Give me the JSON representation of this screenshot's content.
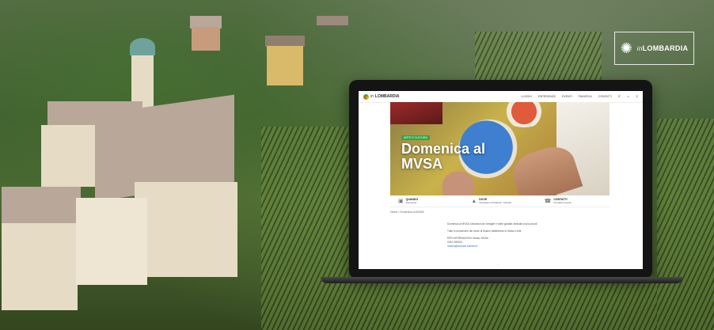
{
  "brand": {
    "logo_prefix": "in",
    "logo_name": "LOMBARDIA",
    "logo_icon": "sun-icon"
  },
  "site": {
    "brand_prefix": "in",
    "brand_name": "LOMBARDIA",
    "nav_items": [
      "LUOGHI",
      "ESPERIENZE",
      "EVENTI",
      "PIANIFICA",
      "CONTATTI",
      "IT"
    ],
    "search_icon": "search-icon",
    "user_icon": "user-icon"
  },
  "hero": {
    "tag": "ARTE E CULTURA",
    "title_line1": "Domenica al",
    "title_line2": "MVSA"
  },
  "info_bar": [
    {
      "icon": "calendar-icon",
      "label": "QUANDO",
      "value": "Domenica"
    },
    {
      "icon": "pin-icon",
      "label": "DOVE",
      "value": "Via Museo di Palazzo, Sondrio"
    },
    {
      "icon": "phone-icon",
      "label": "CONTATTI",
      "value": "Contatta l'evento"
    }
  ],
  "breadcrumb": "Home / Domenica al MVSA",
  "body": {
    "p1": "Domenica al MVSA: laboratori per famiglie e visite guidate dedicate ai più piccoli.",
    "p2": "Tutte le domeniche del mese al Museo Valtellinese di Storia e Arte.",
    "info_label": "PER INFORMAZIONI: Museo MVSA",
    "phone": "0342 526269",
    "email": "museo@comune.sondrio.it"
  },
  "pager": "‹"
}
